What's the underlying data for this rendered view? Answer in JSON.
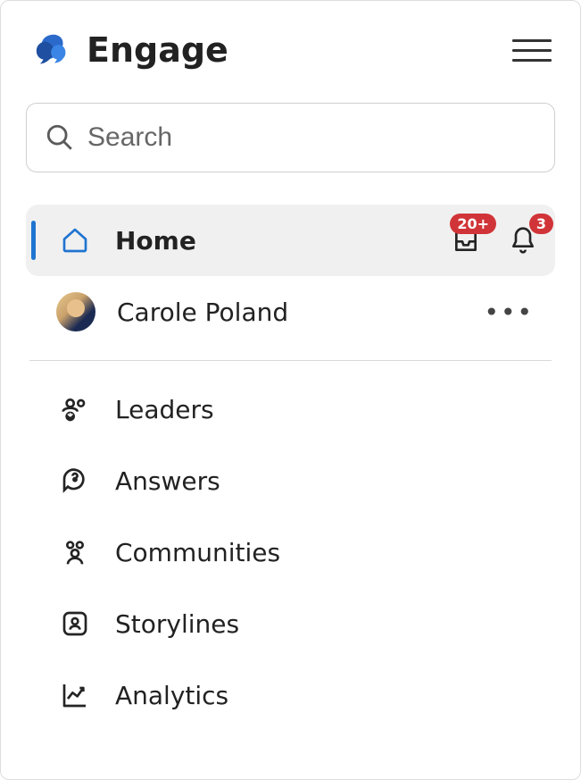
{
  "header": {
    "app_title": "Engage"
  },
  "search": {
    "placeholder": "Search"
  },
  "nav": {
    "home_label": "Home",
    "inbox_badge": "20+",
    "bell_badge": "3"
  },
  "profile": {
    "name": "Carole Poland"
  },
  "menu": {
    "leaders": "Leaders",
    "answers": "Answers",
    "communities": "Communities",
    "storylines": "Storylines",
    "analytics": "Analytics"
  }
}
